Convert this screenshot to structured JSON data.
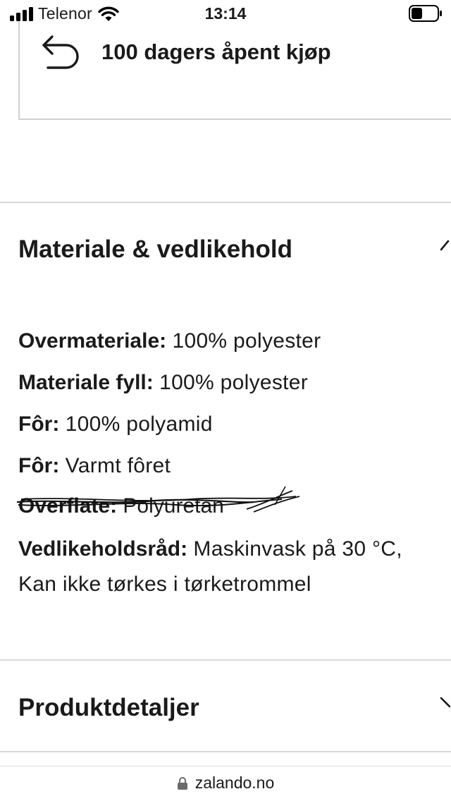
{
  "status_bar": {
    "carrier": "Telenor",
    "time": "13:14"
  },
  "return_policy": {
    "icon": "return-arrow-icon",
    "label": "100 dagers åpent kjøp"
  },
  "material_section": {
    "title": "Materiale & vedlikehold",
    "expanded": true,
    "specs": [
      {
        "label": "Overmateriale:",
        "value": "100% polyester"
      },
      {
        "label": "Materiale fyll:",
        "value": "100% polyester"
      },
      {
        "label": "Fôr:",
        "value": "100% polyamid"
      },
      {
        "label": "Fôr:",
        "value": "Varmt fôret"
      },
      {
        "label": "Overflate:",
        "value": "Polyuretan",
        "struck_out": true
      },
      {
        "label": "Vedlikeholdsråd:",
        "value": "Maskinvask på 30 °C,",
        "value_continued": "Kan ikke tørkes i tørketrommel"
      }
    ]
  },
  "product_details_section": {
    "title": "Produktdetaljer",
    "expanded": false
  },
  "browser": {
    "url": "zalando.no",
    "icon": "lock-icon"
  }
}
